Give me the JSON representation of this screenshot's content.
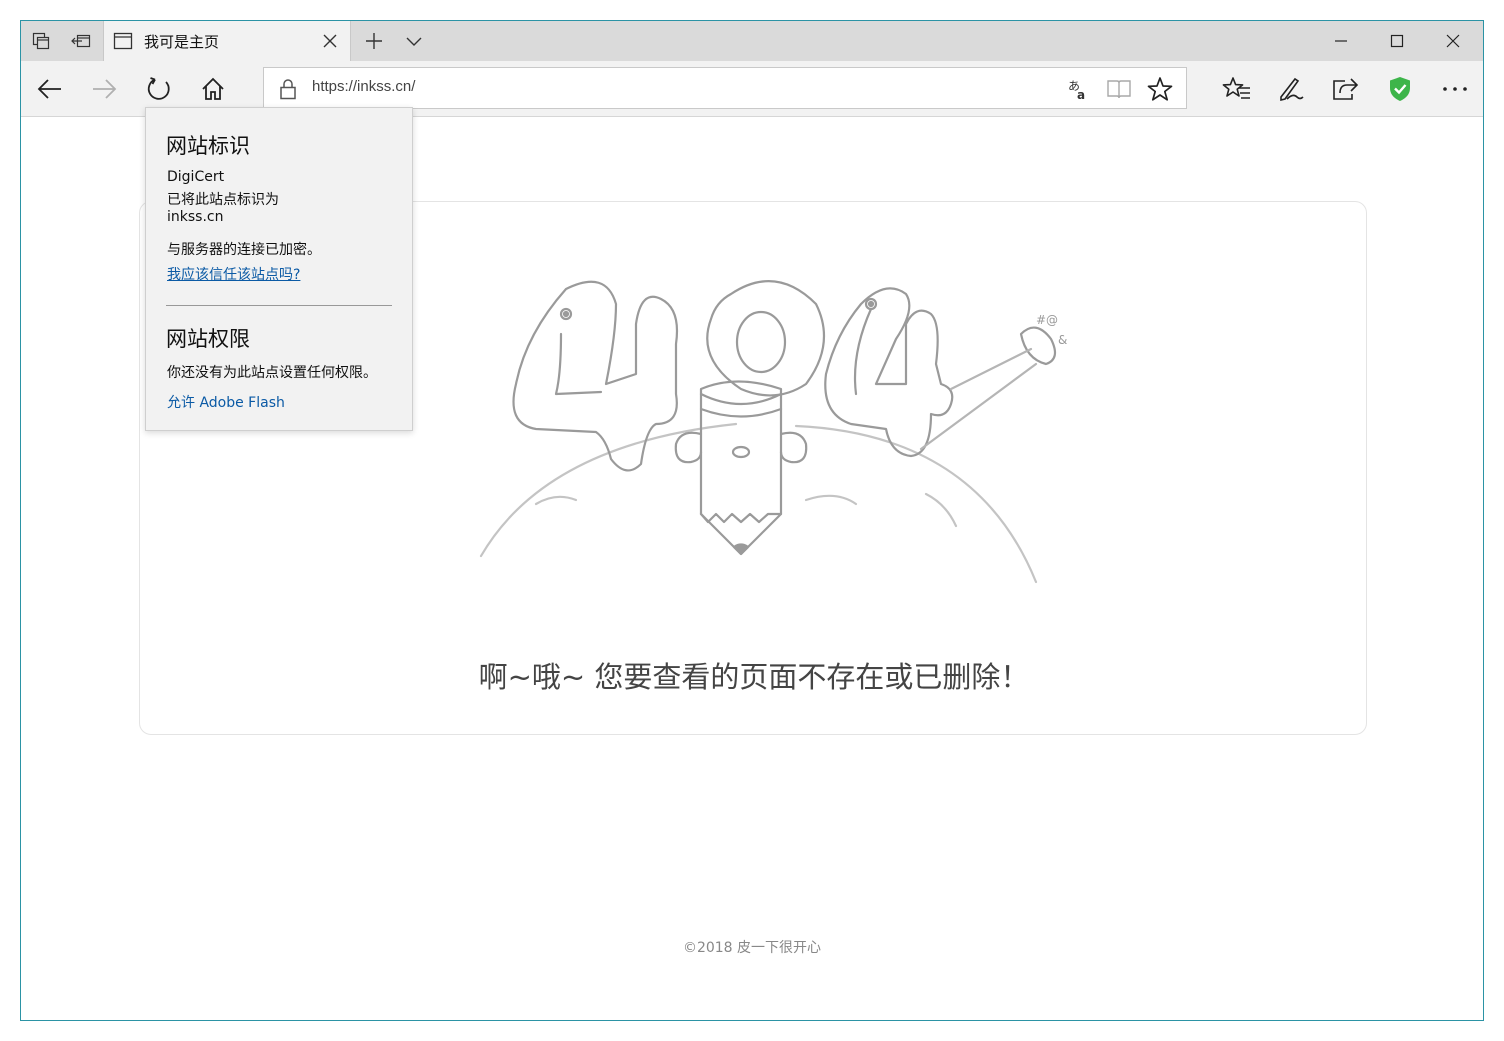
{
  "tab": {
    "title": "我可是主页"
  },
  "address": {
    "url": "https://inkss.cn/"
  },
  "flyout": {
    "identity_heading": "网站标识",
    "issuer": "DigiCert",
    "identified_text": "已将此站点标识为",
    "domain": "inkss.cn",
    "encrypted_text": "与服务器的连接已加密。",
    "trust_link": "我应该信任该站点吗?",
    "permissions_heading": "网站权限",
    "no_permissions_text": "你还没有为此站点设置任何权限。",
    "flash_link": "允许 Adobe Flash"
  },
  "page": {
    "message": "啊~哦~ 您要查看的页面不存在或已删除！",
    "footer": "©2018 皮一下很开心"
  },
  "icons": {
    "tab_bar": [
      "tab-preview-icon",
      "set-aside-tabs-icon",
      "new-tab-plus-icon",
      "tab-list-chevron-icon"
    ],
    "window": [
      "minimize-icon",
      "maximize-icon",
      "close-window-icon"
    ],
    "nav": [
      "back-arrow-icon",
      "forward-arrow-icon",
      "refresh-icon",
      "home-icon"
    ],
    "address": [
      "lock-icon",
      "translate-icon",
      "reading-view-icon",
      "favorite-star-icon"
    ],
    "toolbar": [
      "favorites-hub-icon",
      "web-note-pen-icon",
      "share-icon",
      "adblock-shield-icon",
      "more-dots-icon"
    ]
  },
  "colors": {
    "shield": "#3db54a",
    "link": "#0b5aa5",
    "window_border": "#2b93a5"
  }
}
